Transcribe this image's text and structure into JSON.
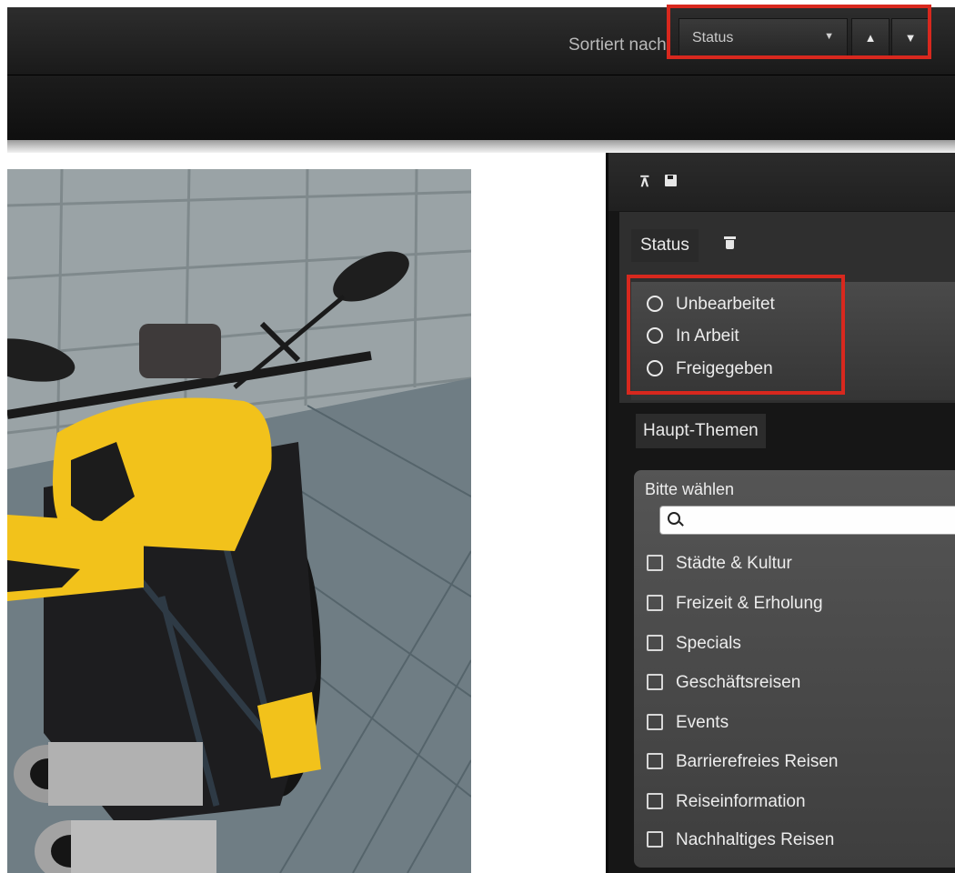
{
  "sort": {
    "label": "Sortiert nach:",
    "selected": "Status",
    "caret_icon": "chevron-down-icon",
    "asc_icon": "triangle-up-icon",
    "desc_icon": "triangle-down-icon"
  },
  "panel": {
    "toolbar_icons": [
      "pin-icon",
      "save-icon"
    ],
    "status": {
      "label": "Status",
      "options": [
        "Unbearbeitet",
        "In Arbeit",
        "Freigegeben"
      ]
    },
    "topics": {
      "label": "Haupt-Themen",
      "choose_label": "Bitte wählen",
      "search_placeholder": "",
      "items": [
        "Städte & Kultur",
        "Freizeit & Erholung",
        "Specials",
        "Geschäftsreisen",
        "Events",
        "Barrierefreies Reisen",
        "Reiseinformation",
        "Nachhaltiges Reisen"
      ]
    }
  },
  "colors": {
    "highlight": "#d8281e",
    "toolbar_dark": "#1a1a1a",
    "panel_bg": "#161616",
    "motorcycle_yellow": "#f2c21b"
  }
}
